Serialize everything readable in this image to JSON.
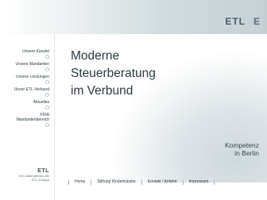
{
  "logo": {
    "left": "ETL",
    "right": "E"
  },
  "sidebar": {
    "items": [
      {
        "label": "Unsere Kanzlei"
      },
      {
        "label": "Unsere Mandanten"
      },
      {
        "label": "Unsere Leistungen"
      },
      {
        "label": "Unser ETL-Verbund"
      },
      {
        "label": "Aktuelles"
      },
      {
        "label": "PDIA",
        "label2": "Mandantenbereich"
      }
    ]
  },
  "hero": {
    "line1": "Moderne",
    "line2": "Steuerberatung",
    "line3": "im Verbund"
  },
  "tagline": {
    "line1": "Kompetenz",
    "line2": "in Berlin"
  },
  "footer_logo": {
    "name": "ETL",
    "line1": "Ein Unternehmen der",
    "line2": "ETL-Gruppe"
  },
  "footer_nav": [
    {
      "label": "Home"
    },
    {
      "label": "Stiftung Kinderträume"
    },
    {
      "label": "Kontakt / Anfahrt"
    },
    {
      "label": "Impressum"
    }
  ]
}
